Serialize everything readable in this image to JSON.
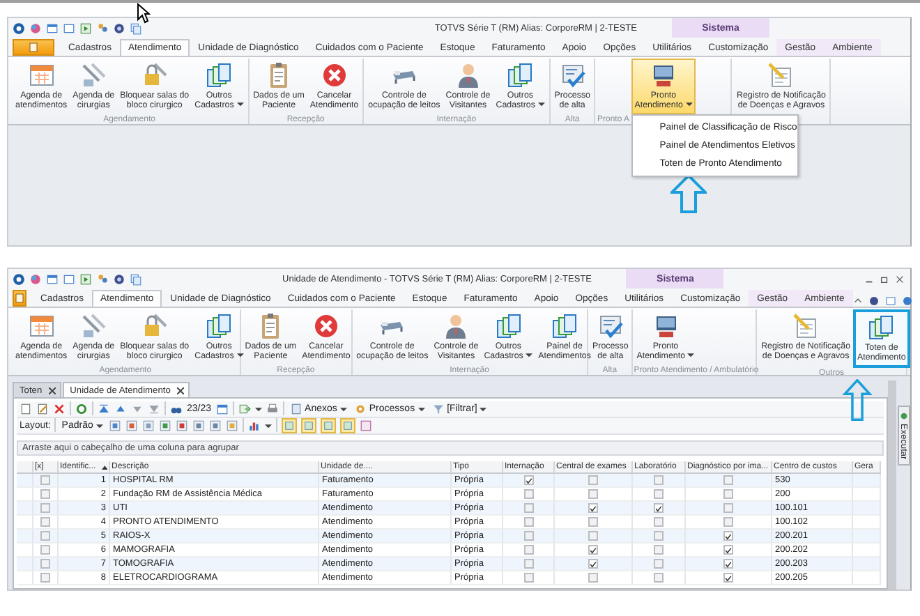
{
  "top_window": {
    "title": "TOTVS Série T  (RM) Alias: CorporeRM | 2-TESTE",
    "context": "Sistema",
    "tabs": [
      {
        "label": "Cadastros",
        "selected": false,
        "context": false
      },
      {
        "label": "Atendimento",
        "selected": true,
        "context": false
      },
      {
        "label": "Unidade de Diagnóstico",
        "selected": false,
        "context": false
      },
      {
        "label": "Cuidados com o Paciente",
        "selected": false,
        "context": false
      },
      {
        "label": "Estoque",
        "selected": false,
        "context": false
      },
      {
        "label": "Faturamento",
        "selected": false,
        "context": false
      },
      {
        "label": "Apoio",
        "selected": false,
        "context": false
      },
      {
        "label": "Opções",
        "selected": false,
        "context": false
      },
      {
        "label": "Utilitários",
        "selected": false,
        "context": false
      },
      {
        "label": "Customização",
        "selected": false,
        "context": false
      },
      {
        "label": "Gestão",
        "selected": false,
        "context": true
      },
      {
        "label": "Ambiente",
        "selected": false,
        "context": true
      }
    ],
    "ribbon": [
      {
        "label": "Agendamento",
        "buttons": [
          {
            "label": "Agenda de\natendimentos",
            "dropdown": false
          },
          {
            "label": "Agenda de\ncirurgias",
            "dropdown": false
          },
          {
            "label": "Bloquear salas do\nbloco cirurgico",
            "dropdown": false
          },
          {
            "label": "Outros\nCadastros",
            "dropdown": true
          }
        ]
      },
      {
        "label": "Recepção",
        "buttons": [
          {
            "label": "Dados de um\nPaciente",
            "dropdown": false
          },
          {
            "label": "Cancelar\nAtendimento",
            "dropdown": false
          }
        ]
      },
      {
        "label": "Internação",
        "buttons": [
          {
            "label": "Controle de\nocupação de leitos",
            "dropdown": false
          },
          {
            "label": "Controle de\nVisitantes",
            "dropdown": false
          },
          {
            "label": "Outros\nCadastros",
            "dropdown": true
          }
        ]
      },
      {
        "label": "Alta",
        "buttons": [
          {
            "label": "Processo\nde alta",
            "dropdown": false
          }
        ]
      },
      {
        "label": "Pronto A",
        "buttons": [
          {
            "label": "Pronto\nAtendimento",
            "dropdown": true,
            "hover": true,
            "menu": [
              "Painel de Classificação de Risco",
              "Painel de Atendimentos Eletivos",
              "Toten de Pronto Atendimento"
            ]
          }
        ]
      },
      {
        "buttons": [
          {
            "label": "Registro de Notificação\nde Doenças e Agravos",
            "dropdown": false
          }
        ]
      }
    ]
  },
  "bottom_window": {
    "title": "Unidade de Atendimento - TOTVS Série T  (RM) Alias: CorporeRM | 2-TESTE",
    "context": "Sistema",
    "tabs": [
      {
        "label": "Cadastros",
        "selected": false,
        "context": false
      },
      {
        "label": "Atendimento",
        "selected": true,
        "context": false
      },
      {
        "label": "Unidade de Diagnóstico",
        "selected": false,
        "context": false
      },
      {
        "label": "Cuidados com o Paciente",
        "selected": false,
        "context": false
      },
      {
        "label": "Estoque",
        "selected": false,
        "context": false
      },
      {
        "label": "Faturamento",
        "selected": false,
        "context": false
      },
      {
        "label": "Apoio",
        "selected": false,
        "context": false
      },
      {
        "label": "Opções",
        "selected": false,
        "context": false
      },
      {
        "label": "Utilitários",
        "selected": false,
        "context": false
      },
      {
        "label": "Customização",
        "selected": false,
        "context": false
      },
      {
        "label": "Gestão",
        "selected": false,
        "context": true
      },
      {
        "label": "Ambiente",
        "selected": false,
        "context": true
      }
    ],
    "ribbon": [
      {
        "label": "Agendamento",
        "buttons": [
          {
            "label": "Agenda de\natendimentos",
            "dropdown": false
          },
          {
            "label": "Agenda de\ncirurgias",
            "dropdown": false
          },
          {
            "label": "Bloquear salas do\nbloco cirurgico",
            "dropdown": false
          },
          {
            "label": "Outros\nCadastros",
            "dropdown": true
          }
        ]
      },
      {
        "label": "Recepção",
        "buttons": [
          {
            "label": "Dados de um\nPaciente",
            "dropdown": false
          },
          {
            "label": "Cancelar\nAtendimento",
            "dropdown": false
          }
        ]
      },
      {
        "label": "Internação",
        "buttons": [
          {
            "label": "Controle de\nocupação de leitos",
            "dropdown": false
          },
          {
            "label": "Controle de\nVisitantes",
            "dropdown": false
          },
          {
            "label": "Outros\nCadastros",
            "dropdown": true
          },
          {
            "label": "Painel de\nAtendimentos",
            "dropdown": false
          }
        ]
      },
      {
        "label": "Alta",
        "buttons": [
          {
            "label": "Processo\nde alta",
            "dropdown": false
          }
        ]
      },
      {
        "label": "Pronto Atendimento / Ambulatório",
        "buttons": [
          {
            "label": "Pronto\nAtendimento",
            "dropdown": true
          }
        ]
      },
      {
        "label": "Outros",
        "buttons": [
          {
            "label": "Registro de Notificação\nde Doenças e Agravos",
            "dropdown": false
          },
          {
            "label": "Toten de\nAtendimento",
            "dropdown": false,
            "outlined": true
          }
        ]
      }
    ],
    "doc_tabs": [
      {
        "label": "Toten",
        "selected": false
      },
      {
        "label": "Unidade de Atendimento",
        "selected": true
      }
    ],
    "counter": "23/23",
    "toolbar_buttons": [
      {
        "label": "Anexos",
        "dropdown": true
      },
      {
        "label": "Processos",
        "dropdown": true
      },
      {
        "label": "[Filtrar]",
        "dropdown": true
      }
    ],
    "layout_label": "Layout:",
    "layout_value": "Padrão",
    "group_panel": "Arraste aqui o cabeçalho de uma coluna para agrupar",
    "table": {
      "columns": [
        {
          "label": "[x]",
          "kind": "check"
        },
        {
          "label": "Identific...",
          "kind": "num",
          "sorted": true
        },
        {
          "label": "Descrição",
          "kind": "text"
        },
        {
          "label": "Unidade de....",
          "kind": "text"
        },
        {
          "label": "Tipo",
          "kind": "text"
        },
        {
          "label": "Internação",
          "kind": "check"
        },
        {
          "label": "Central de exames",
          "kind": "check"
        },
        {
          "label": "Laboratório",
          "kind": "check"
        },
        {
          "label": "Diagnóstico por ima...",
          "kind": "check"
        },
        {
          "label": "Centro de custos",
          "kind": "text"
        },
        {
          "label": "Gera",
          "kind": "text"
        }
      ],
      "rows": [
        {
          "cells": [
            false,
            "1",
            "HOSPITAL RM",
            "Faturamento",
            "Própria",
            true,
            false,
            false,
            false,
            "530"
          ]
        },
        {
          "cells": [
            false,
            "2",
            "Fundação RM de Assistência Médica",
            "Faturamento",
            "Própria",
            false,
            false,
            false,
            false,
            "200"
          ]
        },
        {
          "cells": [
            false,
            "3",
            "UTI",
            "Atendimento",
            "Própria",
            false,
            true,
            true,
            false,
            "100.101"
          ]
        },
        {
          "cells": [
            false,
            "4",
            "PRONTO ATENDIMENTO",
            "Atendimento",
            "Própria",
            false,
            false,
            false,
            false,
            "100.102"
          ]
        },
        {
          "cells": [
            false,
            "5",
            "RAIOS-X",
            "Atendimento",
            "Própria",
            false,
            false,
            false,
            true,
            "200.201"
          ]
        },
        {
          "cells": [
            false,
            "6",
            "MAMOGRAFIA",
            "Atendimento",
            "Própria",
            false,
            true,
            false,
            true,
            "200.202"
          ]
        },
        {
          "cells": [
            false,
            "7",
            "TOMOGRAFIA",
            "Atendimento",
            "Própria",
            false,
            true,
            false,
            true,
            "200.203"
          ]
        },
        {
          "cells": [
            false,
            "8",
            "ELETROCARDIOGRAMA",
            "Atendimento",
            "Própria",
            false,
            false,
            false,
            true,
            "200.205"
          ]
        }
      ]
    },
    "side_tab": "Executar"
  }
}
